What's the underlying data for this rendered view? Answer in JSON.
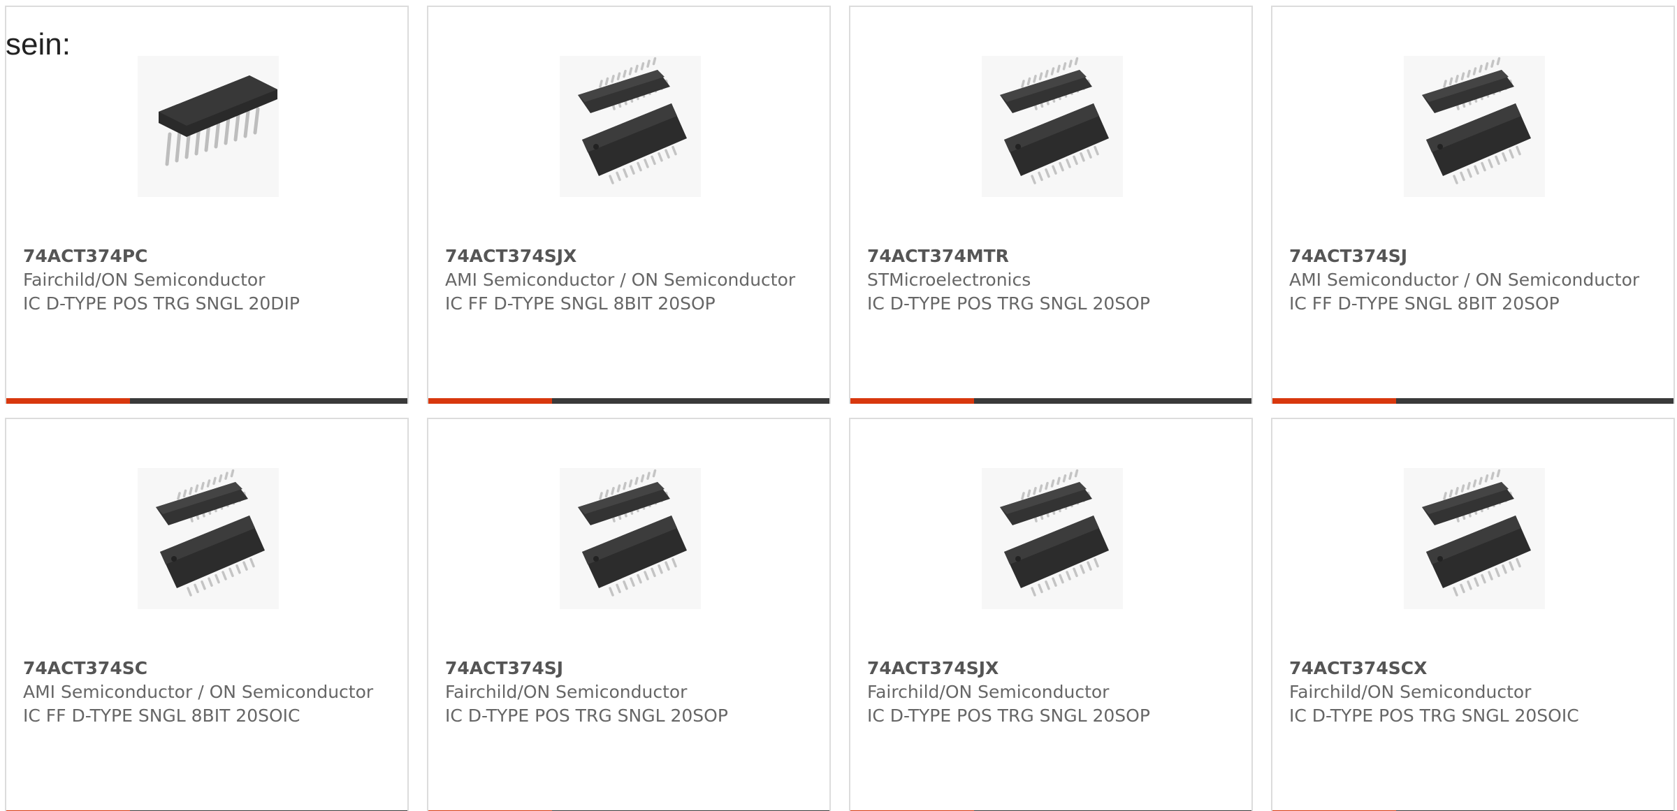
{
  "intro": {
    "text": "sein:"
  },
  "colors": {
    "accent": "#d8380e",
    "bar": "#3a3a3a",
    "border": "#dcdcdc",
    "text": "#666666",
    "title": "#555555"
  },
  "products": [
    {
      "part": "74ACT374PC",
      "manufacturer": "Fairchild/ON Semiconductor",
      "description": "IC D-TYPE POS TRG SNGL 20DIP",
      "image": "dip-chip-icon",
      "accent_fraction": 0.31
    },
    {
      "part": "74ACT374SJX",
      "manufacturer": "AMI Semiconductor / ON Semiconductor",
      "description": "IC FF D-TYPE SNGL 8BIT 20SOP",
      "image": "soic-chip-icon",
      "accent_fraction": 0.31
    },
    {
      "part": "74ACT374MTR",
      "manufacturer": "STMicroelectronics",
      "description": "IC D-TYPE POS TRG SNGL 20SOP",
      "image": "soic-chip-icon",
      "accent_fraction": 0.31
    },
    {
      "part": "74ACT374SJ",
      "manufacturer": "AMI Semiconductor / ON Semiconductor",
      "description": "IC FF D-TYPE SNGL 8BIT 20SOP",
      "image": "soic-chip-icon",
      "accent_fraction": 0.31
    },
    {
      "part": "74ACT374SC",
      "manufacturer": "AMI Semiconductor / ON Semiconductor",
      "description": "IC FF D-TYPE SNGL 8BIT 20SOIC",
      "image": "soic-chip-icon",
      "accent_fraction": 0.31
    },
    {
      "part": "74ACT374SJ",
      "manufacturer": "Fairchild/ON Semiconductor",
      "description": "IC D-TYPE POS TRG SNGL 20SOP",
      "image": "soic-chip-icon",
      "accent_fraction": 0.31
    },
    {
      "part": "74ACT374SJX",
      "manufacturer": "Fairchild/ON Semiconductor",
      "description": "IC D-TYPE POS TRG SNGL 20SOP",
      "image": "soic-chip-icon",
      "accent_fraction": 0.31
    },
    {
      "part": "74ACT374SCX",
      "manufacturer": "Fairchild/ON Semiconductor",
      "description": "IC D-TYPE POS TRG SNGL 20SOIC",
      "image": "soic-chip-icon",
      "accent_fraction": 0.31
    }
  ]
}
